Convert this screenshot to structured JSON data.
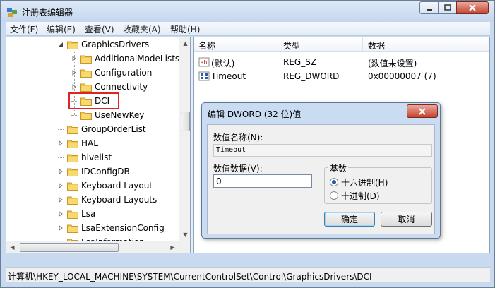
{
  "window": {
    "title": "注册表编辑器"
  },
  "menu": [
    "文件(F)",
    "编辑(E)",
    "查看(V)",
    "收藏夹(A)",
    "帮助(H)"
  ],
  "tree": {
    "items": [
      {
        "label": "GraphicsDrivers",
        "level": 0,
        "expander": "open"
      },
      {
        "label": "AdditionalModeLists",
        "level": 1,
        "expander": "closed"
      },
      {
        "label": "Configuration",
        "level": 1,
        "expander": "closed"
      },
      {
        "label": "Connectivity",
        "level": 1,
        "expander": "closed"
      },
      {
        "label": "DCI",
        "level": 1,
        "expander": "none"
      },
      {
        "label": "UseNewKey",
        "level": 1,
        "expander": "none"
      },
      {
        "label": "GroupOrderList",
        "level": 0,
        "expander": "none"
      },
      {
        "label": "HAL",
        "level": 0,
        "expander": "closed"
      },
      {
        "label": "hivelist",
        "level": 0,
        "expander": "none"
      },
      {
        "label": "IDConfigDB",
        "level": 0,
        "expander": "closed"
      },
      {
        "label": "Keyboard Layout",
        "level": 0,
        "expander": "closed"
      },
      {
        "label": "Keyboard Layouts",
        "level": 0,
        "expander": "closed"
      },
      {
        "label": "Lsa",
        "level": 0,
        "expander": "closed"
      },
      {
        "label": "LsaExtensionConfig",
        "level": 0,
        "expander": "closed"
      },
      {
        "label": "LsaInformation",
        "level": 0,
        "expander": "none"
      }
    ]
  },
  "list": {
    "columns": [
      "名称",
      "类型",
      "数据"
    ],
    "rows": [
      {
        "icon": "string-value-icon",
        "name": "(默认)",
        "type": "REG_SZ",
        "data": "(数值未设置)"
      },
      {
        "icon": "dword-value-icon",
        "name": "Timeout",
        "type": "REG_DWORD",
        "data": "0x00000007 (7)"
      }
    ]
  },
  "dialog": {
    "title": "编辑 DWORD (32 位)值",
    "name_label": "数值名称(N):",
    "name_value": "Timeout",
    "data_label": "数值数据(V):",
    "data_value": "0",
    "base_label": "基数",
    "radio_hex": "十六进制(H)",
    "radio_dec": "十进制(D)",
    "selected_base": "hex",
    "ok": "确定",
    "cancel": "取消"
  },
  "status": {
    "path": "计算机\\HKEY_LOCAL_MACHINE\\SYSTEM\\CurrentControlSet\\Control\\GraphicsDrivers\\DCI"
  },
  "colors": {
    "folder": "#f3c74c",
    "highlight": "#e02424",
    "title_bar": "#c4d6ee"
  }
}
